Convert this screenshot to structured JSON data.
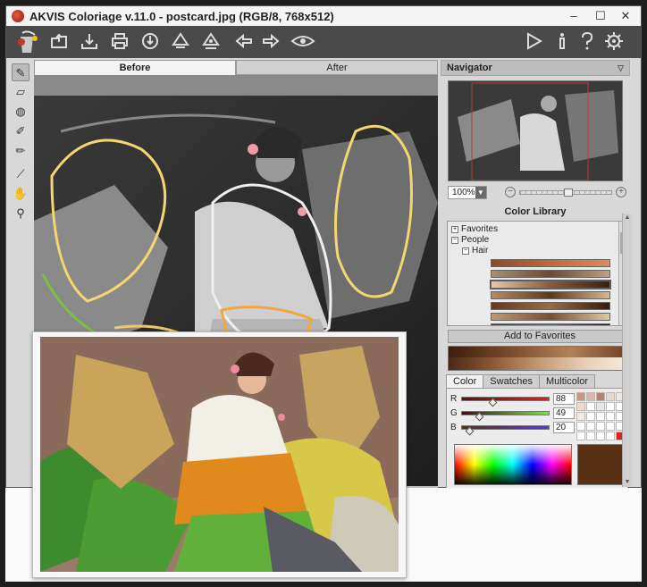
{
  "window": {
    "title": "AKVIS Coloriage v.11.0 - postcard.jpg (RGB/8, 768x512)",
    "controls": {
      "minimize": "–",
      "maximize": "☐",
      "close": "✕"
    }
  },
  "toolbar": {
    "left_icons": [
      "coloriage-logo-icon",
      "open-icon",
      "save-icon",
      "print-icon",
      "load-strokes-icon",
      "save-strokes-icon",
      "share-icon",
      "back-icon",
      "forward-icon",
      "preview-eye-icon"
    ],
    "right_icons": [
      "run-icon",
      "info-icon",
      "help-icon",
      "settings-icon"
    ]
  },
  "tools": [
    "pencil-icon",
    "eraser-icon",
    "bucket-icon",
    "magic-tube-icon",
    "chain-pencil-icon",
    "eyedropper-icon",
    "hand-icon",
    "zoom-icon"
  ],
  "tabs": {
    "before": "Before",
    "after": "After"
  },
  "navigator": {
    "title": "Navigator",
    "zoom": "100%",
    "zoom_out": "−",
    "zoom_in": "+"
  },
  "color_library": {
    "title": "Color Library",
    "tree": [
      {
        "label": "Favorites",
        "expander": "+"
      },
      {
        "label": "People",
        "expander": "−"
      },
      {
        "label": "Hair",
        "expander": "−"
      }
    ],
    "swatch_rows": [
      [
        "#8a4a2a",
        "#c06a3a",
        "#e08a5a"
      ],
      [
        "#a89070",
        "#6a4a30",
        "#c0a080"
      ],
      [
        "#e8c8a8",
        "#8a5a38",
        "#3a2010"
      ],
      [
        "#b88a60",
        "#5a3a20",
        "#d8b890"
      ],
      [
        "#6a3a1a",
        "#9a6a40",
        "#3a1a0a"
      ],
      [
        "#c09870",
        "#7a5030",
        "#e0c8a0"
      ],
      [
        "#5a3018",
        "#8a5a30",
        "#2a1408"
      ],
      [
        "#a07048",
        "#4a2812",
        "#c8a078"
      ]
    ],
    "add_to_favorites": "Add to Favorites"
  },
  "color_tabs": [
    "Color",
    "Swatches",
    "Multicolor"
  ],
  "rgb": {
    "r_label": "R",
    "r_value": "88",
    "g_label": "G",
    "g_value": "49",
    "b_label": "B",
    "b_value": "20"
  },
  "mini_swatches": [
    "#c89880",
    "#d8b8a8",
    "#b88070",
    "#e8d8d0",
    "#f0e8e0",
    "#f4d8c8",
    "#ffffff",
    "#e8e8e8",
    "#ffffff",
    "#ffffff",
    "#f8e8e0",
    "#ffffff",
    "#ffffff",
    "#ffffff",
    "#ffffff",
    "#ffffff",
    "#ffffff",
    "#ffffff",
    "#ffffff",
    "#ffffff",
    "#ffffff",
    "#ffffff",
    "#ffffff",
    "#ffffff",
    "#e02020"
  ],
  "current_color": "#583114"
}
